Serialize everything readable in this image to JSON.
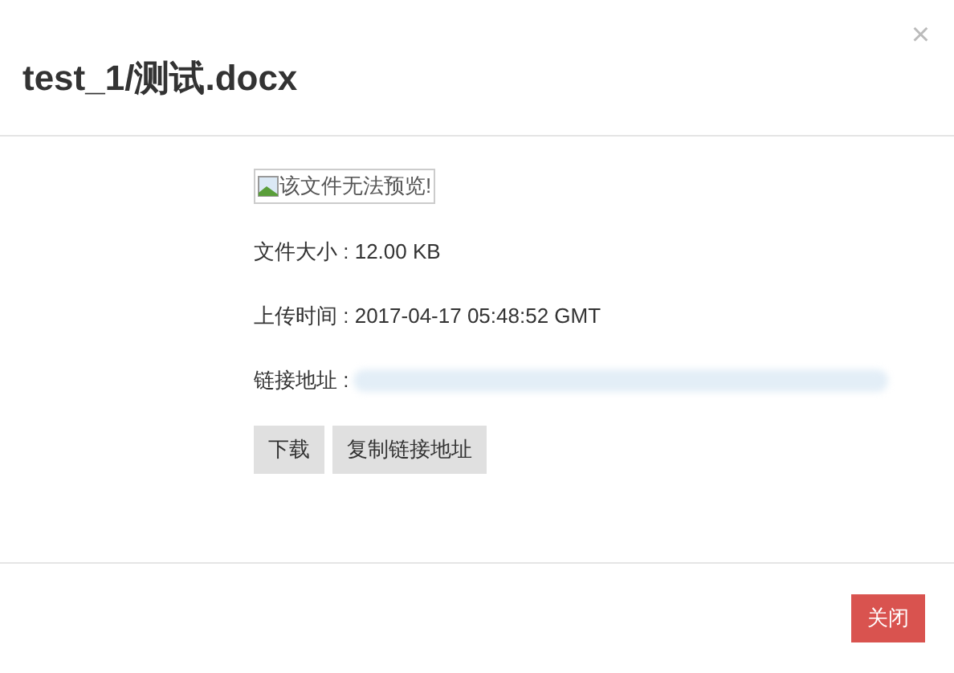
{
  "dialog": {
    "title": "test_1/测试.docx",
    "close_symbol": "×"
  },
  "preview": {
    "alt_text": "该文件无法预览!"
  },
  "details": [
    {
      "label": "文件大小 : ",
      "value": "12.00 KB",
      "kind": "text"
    },
    {
      "label": "上传时间 : ",
      "value": "2017-04-17 05:48:52 GMT",
      "kind": "text"
    },
    {
      "label": "链接地址 : ",
      "kind": "hidden"
    }
  ],
  "actions": [
    "下载",
    "复制链接地址"
  ],
  "footer": {
    "button": "关闭"
  }
}
